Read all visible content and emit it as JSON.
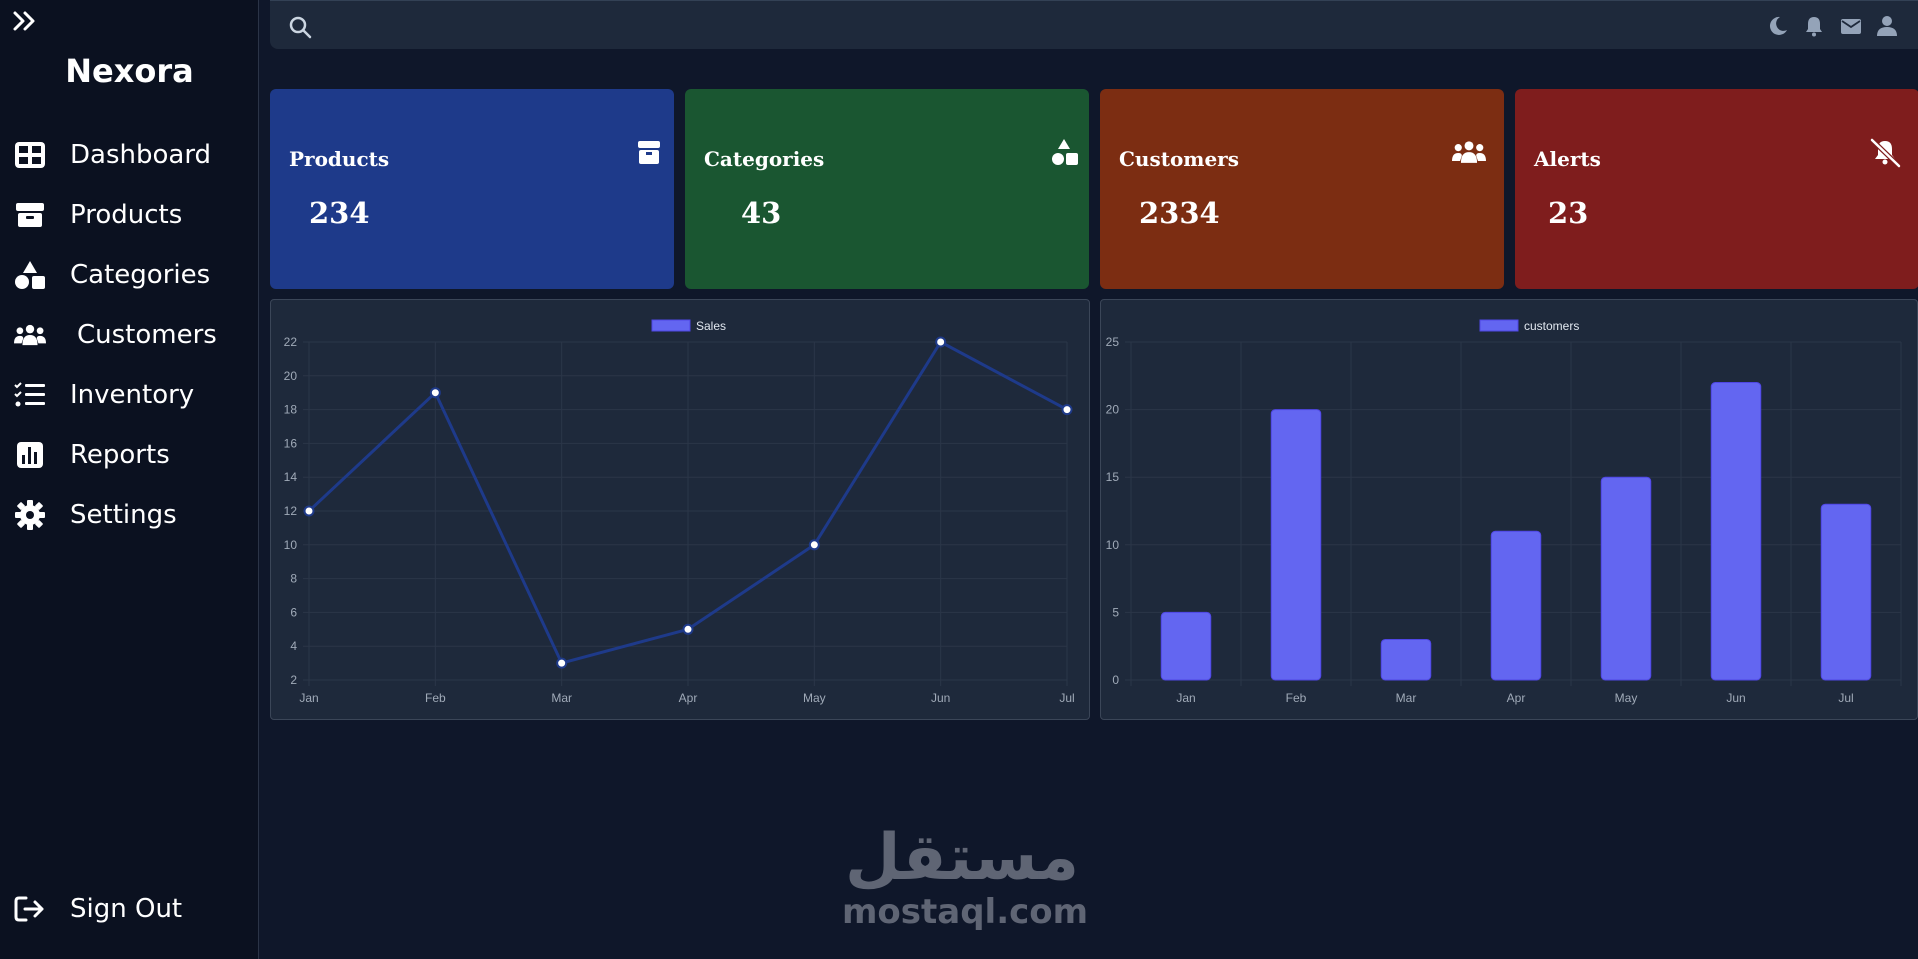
{
  "app": {
    "brand": "Nexora"
  },
  "sidebar": {
    "toggle_icon": "double-chevron-right-icon",
    "items": [
      {
        "label": "Dashboard",
        "icon": "grid-icon"
      },
      {
        "label": "Products",
        "icon": "box-icon"
      },
      {
        "label": "Categories",
        "icon": "shapes-icon"
      },
      {
        "label": "Customers",
        "icon": "users-icon"
      },
      {
        "label": "Inventory",
        "icon": "list-check-icon"
      },
      {
        "label": "Reports",
        "icon": "chart-icon"
      },
      {
        "label": "Settings",
        "icon": "gear-icon"
      }
    ],
    "signout": {
      "label": "Sign Out",
      "icon": "sign-out-icon"
    }
  },
  "topbar": {
    "icons": [
      "search-icon",
      "moon-icon",
      "bell-icon",
      "envelope-icon",
      "user-icon"
    ]
  },
  "cards": [
    {
      "title": "Products",
      "value": "234",
      "color": "#1e3a8a",
      "icon": "box-icon"
    },
    {
      "title": "Categories",
      "value": "43",
      "color": "#1a5631",
      "icon": "shapes-icon"
    },
    {
      "title": "Customers",
      "value": "2334",
      "color": "#7c2d12",
      "icon": "users-icon"
    },
    {
      "title": "Alerts",
      "value": "23",
      "color": "#7f1d1d",
      "icon": "bell-slash-icon"
    }
  ],
  "chart_data": [
    {
      "type": "line",
      "categories": [
        "Jan",
        "Feb",
        "Mar",
        "Apr",
        "May",
        "Jun",
        "Jul"
      ],
      "series": [
        {
          "name": "Sales",
          "values": [
            12,
            19,
            3,
            5,
            10,
            22,
            18
          ]
        }
      ],
      "ylim": [
        2,
        22
      ],
      "yticks": [
        2,
        4,
        6,
        8,
        10,
        12,
        14,
        16,
        18,
        20,
        22
      ],
      "grid": true,
      "legend": "top-center",
      "color": "#1e3a8a",
      "legend_color": "#6366f1"
    },
    {
      "type": "bar",
      "categories": [
        "Jan",
        "Feb",
        "Mar",
        "Apr",
        "May",
        "Jun",
        "Jul"
      ],
      "series": [
        {
          "name": "customers",
          "values": [
            5,
            20,
            3,
            11,
            15,
            22,
            13
          ]
        }
      ],
      "ylim": [
        0,
        25
      ],
      "yticks": [
        0,
        5,
        10,
        15,
        20,
        25
      ],
      "grid": true,
      "legend": "top-center",
      "color": "#6366f1"
    }
  ],
  "watermark": {
    "arabic": "مستقل",
    "latin": "mostaql.com"
  }
}
